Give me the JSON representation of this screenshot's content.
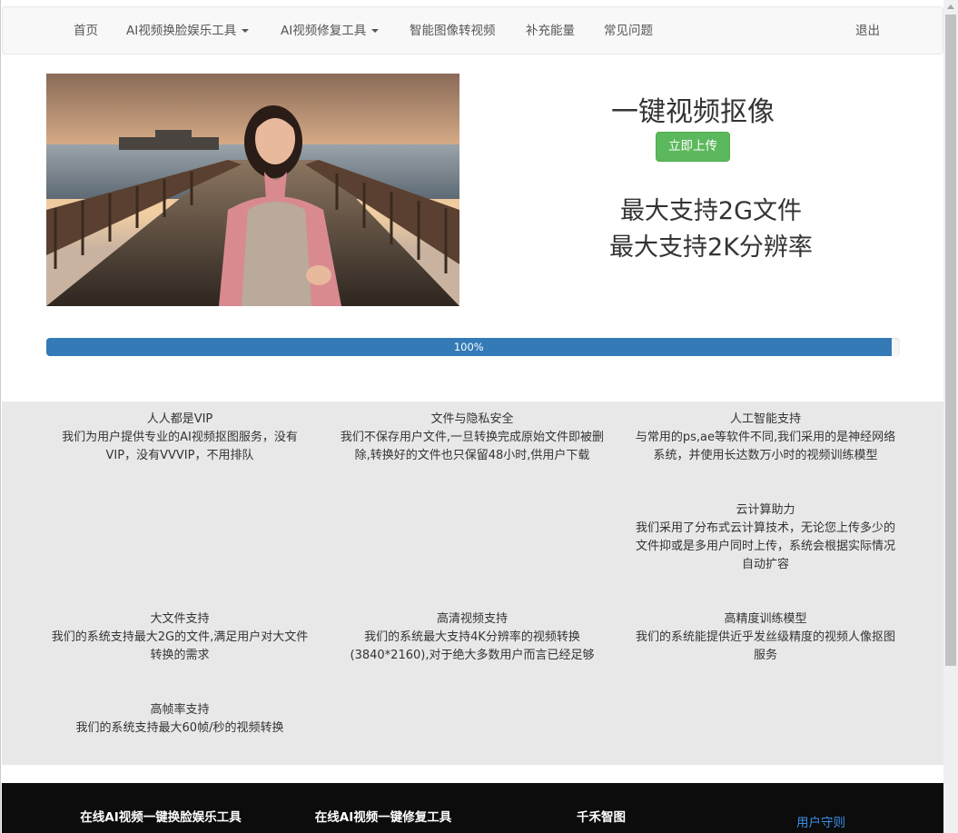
{
  "nav": {
    "items": [
      {
        "label": "首页"
      },
      {
        "label": "AI视频换脸娱乐工具",
        "dropdown": true
      },
      {
        "label": "AI视频修复工具",
        "dropdown": true
      },
      {
        "label": "智能图像转视频"
      },
      {
        "label": "补充能量"
      },
      {
        "label": "常见问题"
      }
    ],
    "logout": "退出"
  },
  "hero": {
    "title": "一键视频抠像",
    "upload_button": "立即上传",
    "spec1": "最大支持2G文件",
    "spec2": "最大支持2K分辨率"
  },
  "progress": {
    "value": 99,
    "label": "100%"
  },
  "features": [
    {
      "title": "人人都是VIP",
      "desc": "我们为用户提供专业的AI视频抠图服务，没有VIP，没有VVVIP，不用排队"
    },
    {
      "title": "文件与隐私安全",
      "desc": "我们不保存用户文件,一旦转换完成原始文件即被删除,转换好的文件也只保留48小时,供用户下载"
    },
    {
      "title": "人工智能支持",
      "desc": "与常用的ps,ae等软件不同,我们采用的是神经网络系统，并使用长达数万小时的视频训练模型"
    },
    {
      "title": "云计算助力",
      "desc": "我们采用了分布式云计算技术，无论您上传多少的文件抑或是多用户同时上传，系统会根据实际情况自动扩容"
    },
    {
      "title": "大文件支持",
      "desc": "我们的系统支持最大2G的文件,满足用户对大文件转换的需求"
    },
    {
      "title": "高清视频支持",
      "desc": "我们的系统最大支持4K分辨率的视频转换(3840*2160),对于绝大多数用户而言已经足够"
    },
    {
      "title": "高精度训练模型",
      "desc": "我们的系统能提供近乎发丝级精度的视频人像抠图服务"
    },
    {
      "title": "高帧率支持",
      "desc": "我们的系统支持最大60帧/秒的视频转换"
    }
  ],
  "footer": {
    "col1": "在线AI视频一键换脸娱乐工具",
    "col2": "在线AI视频一键修复工具",
    "col3": "千禾智图",
    "link": "用户守则"
  },
  "colors": {
    "brand_blue": "#337ab7",
    "success_green": "#5cb85c",
    "feature_bg": "#e8e8e8",
    "footer_bg": "#0c0c0c"
  }
}
